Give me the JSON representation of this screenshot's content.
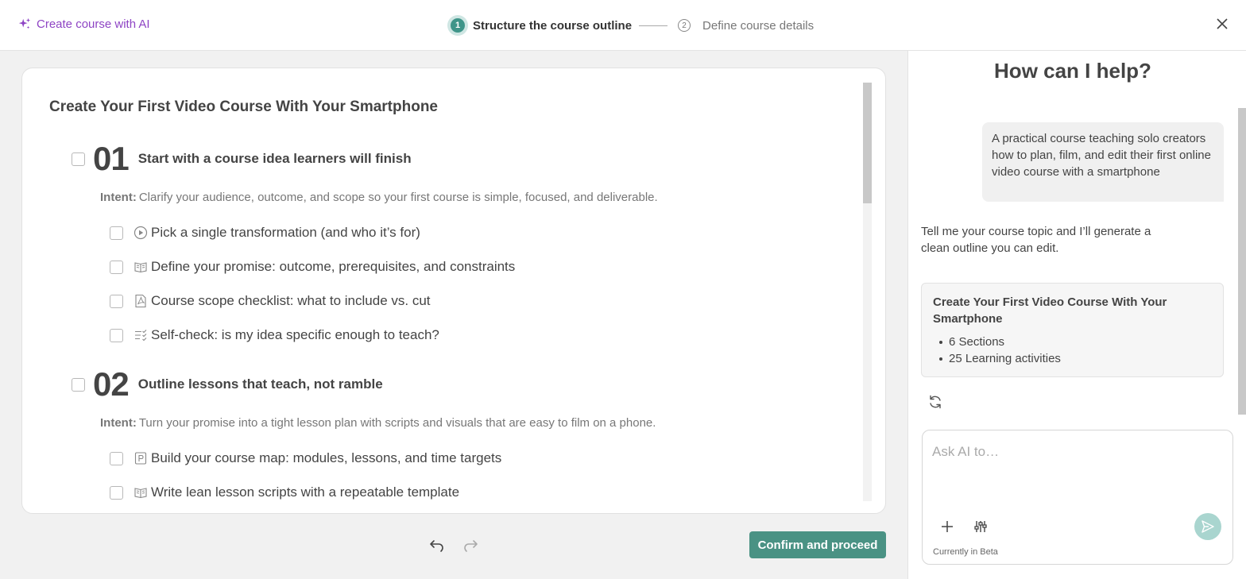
{
  "header": {
    "brand_label": "Create course with AI",
    "steps": [
      {
        "number": "1",
        "label": "Structure the course outline",
        "state": "active"
      },
      {
        "number": "2",
        "label": "Define course details",
        "state": "inactive"
      }
    ]
  },
  "outline": {
    "course_title": "Create Your First Video Course With Your Smartphone",
    "intent_label": "Intent:",
    "sections": [
      {
        "number": "01",
        "title": "Start with a course idea learners will finish",
        "intent": "Clarify your audience, outcome, and scope so your first course is simple, focused, and deliverable.",
        "activities": [
          {
            "icon": "video-icon",
            "label": "Pick a single transformation (and who it’s for)"
          },
          {
            "icon": "book-icon",
            "label": "Define your promise: outcome, prerequisites, and constraints"
          },
          {
            "icon": "pdf-icon",
            "label": "Course scope checklist: what to include vs. cut"
          },
          {
            "icon": "quiz-icon",
            "label": "Self-check: is my idea specific enough to teach?"
          }
        ]
      },
      {
        "number": "02",
        "title": "Outline lessons that teach, not ramble",
        "intent": "Turn your promise into a tight lesson plan with scripts and visuals that are easy to film on a phone.",
        "activities": [
          {
            "icon": "presentation-icon",
            "label": "Build your course map: modules, lessons, and time targets"
          },
          {
            "icon": "book-icon",
            "label": "Write lean lesson scripts with a repeatable template"
          }
        ]
      }
    ]
  },
  "footer": {
    "confirm_label": "Confirm and proceed"
  },
  "assistant": {
    "title": "How can I help?",
    "user_message": "A practical course teaching solo creators how to plan, film, and edit their first online video course with a smartphone",
    "ai_message": "Tell me your course topic and I’ll generate a clean outline you can edit.",
    "summary": {
      "title": "Create Your First Video Course With Your Smartphone",
      "items": [
        "6 Sections",
        "25 Learning activities"
      ]
    },
    "input_placeholder": "Ask AI to…",
    "beta_label": "Currently in Beta"
  },
  "colors": {
    "brand": "#8e44c4",
    "accent": "#4a9284",
    "send_disabled": "#a9d5cf"
  }
}
